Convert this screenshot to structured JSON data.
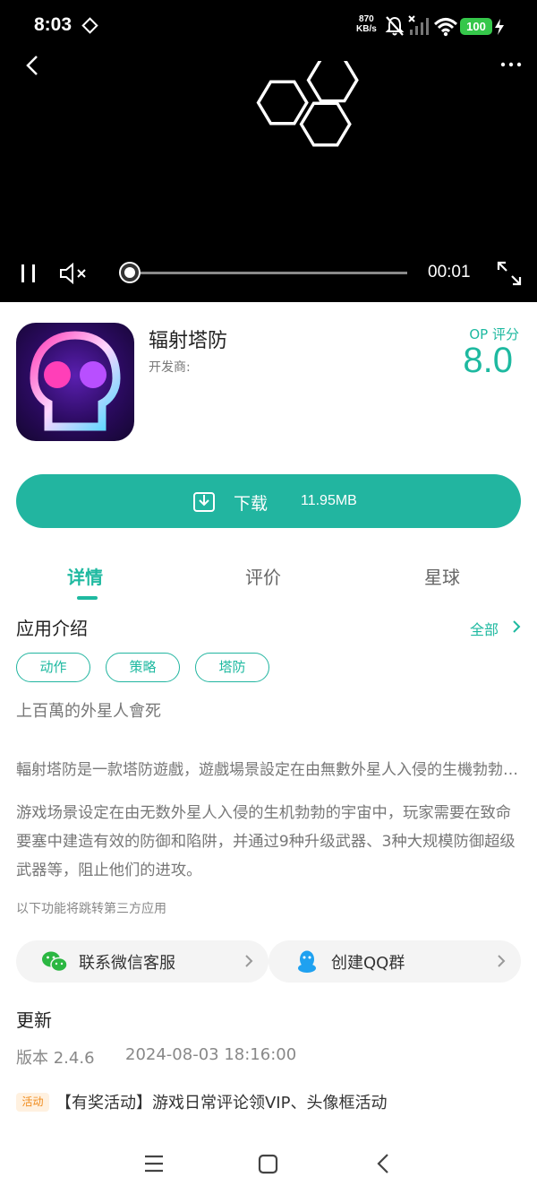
{
  "status_bar": {
    "time": "8:03",
    "speed_value": "870",
    "speed_unit": "KB/s",
    "battery": "100"
  },
  "player": {
    "elapsed": "00:01",
    "progress_fraction": 0.03
  },
  "app": {
    "name": "辐射塔防",
    "developer_label": "开发商:",
    "op_label": "OP 评分",
    "op_score": "8.0"
  },
  "download": {
    "label": "下载",
    "size": "11.95MB"
  },
  "tabs": [
    {
      "label": "详情",
      "active": true
    },
    {
      "label": "评价",
      "active": false
    },
    {
      "label": "星球",
      "active": false
    }
  ],
  "intro": {
    "title": "应用介绍",
    "see_all": "全部",
    "tags": [
      "动作",
      "策略",
      "塔防"
    ],
    "slogan": "上百萬的外星人會死",
    "summary": "輻射塔防是一款塔防遊戲，遊戲場景設定在由無數外星人入侵的生機勃勃的宇宙中，玩家需要在致命要塞中建造有效的防禦和陷阱",
    "description": "游戏场景设定在由无数外星人入侵的生机勃勃的宇宙中，玩家需要在致命要塞中建造有效的防御和陷阱，并通过9种升级武器、3种大规模防御超级武器等，阻止他们的进攻。",
    "third_party_note": "以下功能将跳转第三方应用"
  },
  "contacts": [
    {
      "label": "联系微信客服",
      "icon": "wechat-icon"
    },
    {
      "label": "创建QQ群",
      "icon": "qq-icon"
    }
  ],
  "update": {
    "title": "更新",
    "version": "版本 2.4.6",
    "date": "2024-08-03 18:16:00",
    "event_badge": "活动",
    "event_text": "【有奖活动】游戏日常评论领VIP、头像框活动"
  },
  "colors": {
    "accent": "#22b5a0",
    "battery": "#35c74a",
    "event": "#f08b1c"
  }
}
